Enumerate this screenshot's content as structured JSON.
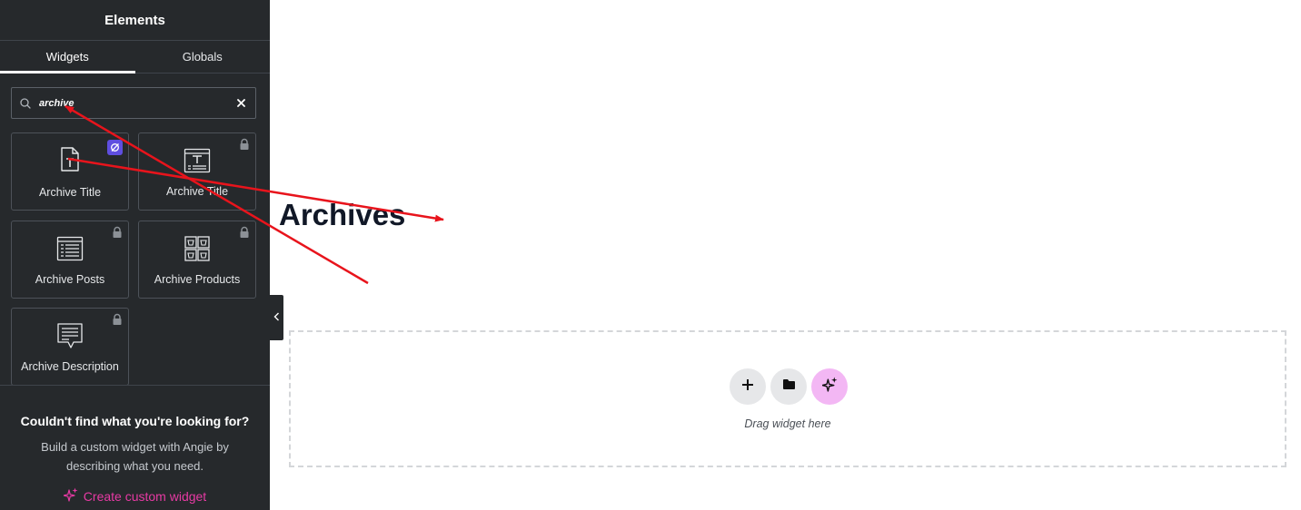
{
  "panel": {
    "title": "Elements",
    "tabs": [
      {
        "label": "Widgets",
        "active": true
      },
      {
        "label": "Globals",
        "active": false
      }
    ],
    "search": {
      "value": "archive",
      "placeholder": "Search Widget..."
    },
    "widgets": [
      {
        "label": "Archive Title",
        "icon": "archive-title-icon",
        "locked": false,
        "badge": "pro-badge-icon"
      },
      {
        "label": "Archive Title",
        "icon": "archive-title-template-icon",
        "locked": true
      },
      {
        "label": "Archive Posts",
        "icon": "archive-posts-icon",
        "locked": true
      },
      {
        "label": "Archive Products",
        "icon": "archive-products-icon",
        "locked": true
      },
      {
        "label": "Archive Description",
        "icon": "archive-description-icon",
        "locked": true
      }
    ],
    "cta": {
      "title": "Couldn't find what you're looking for?",
      "text": "Build a custom widget with Angie by describing what you need.",
      "link": "Create custom widget"
    }
  },
  "canvas": {
    "heading": "Archives",
    "dropzone": {
      "text": "Drag widget here"
    }
  },
  "colors": {
    "panel_bg": "#26292c",
    "accent_pink": "#e73aa4",
    "ai_button": "#f3b7f4",
    "annotation_arrow": "#e8141c",
    "badge_purple": "#5f4ee0"
  }
}
